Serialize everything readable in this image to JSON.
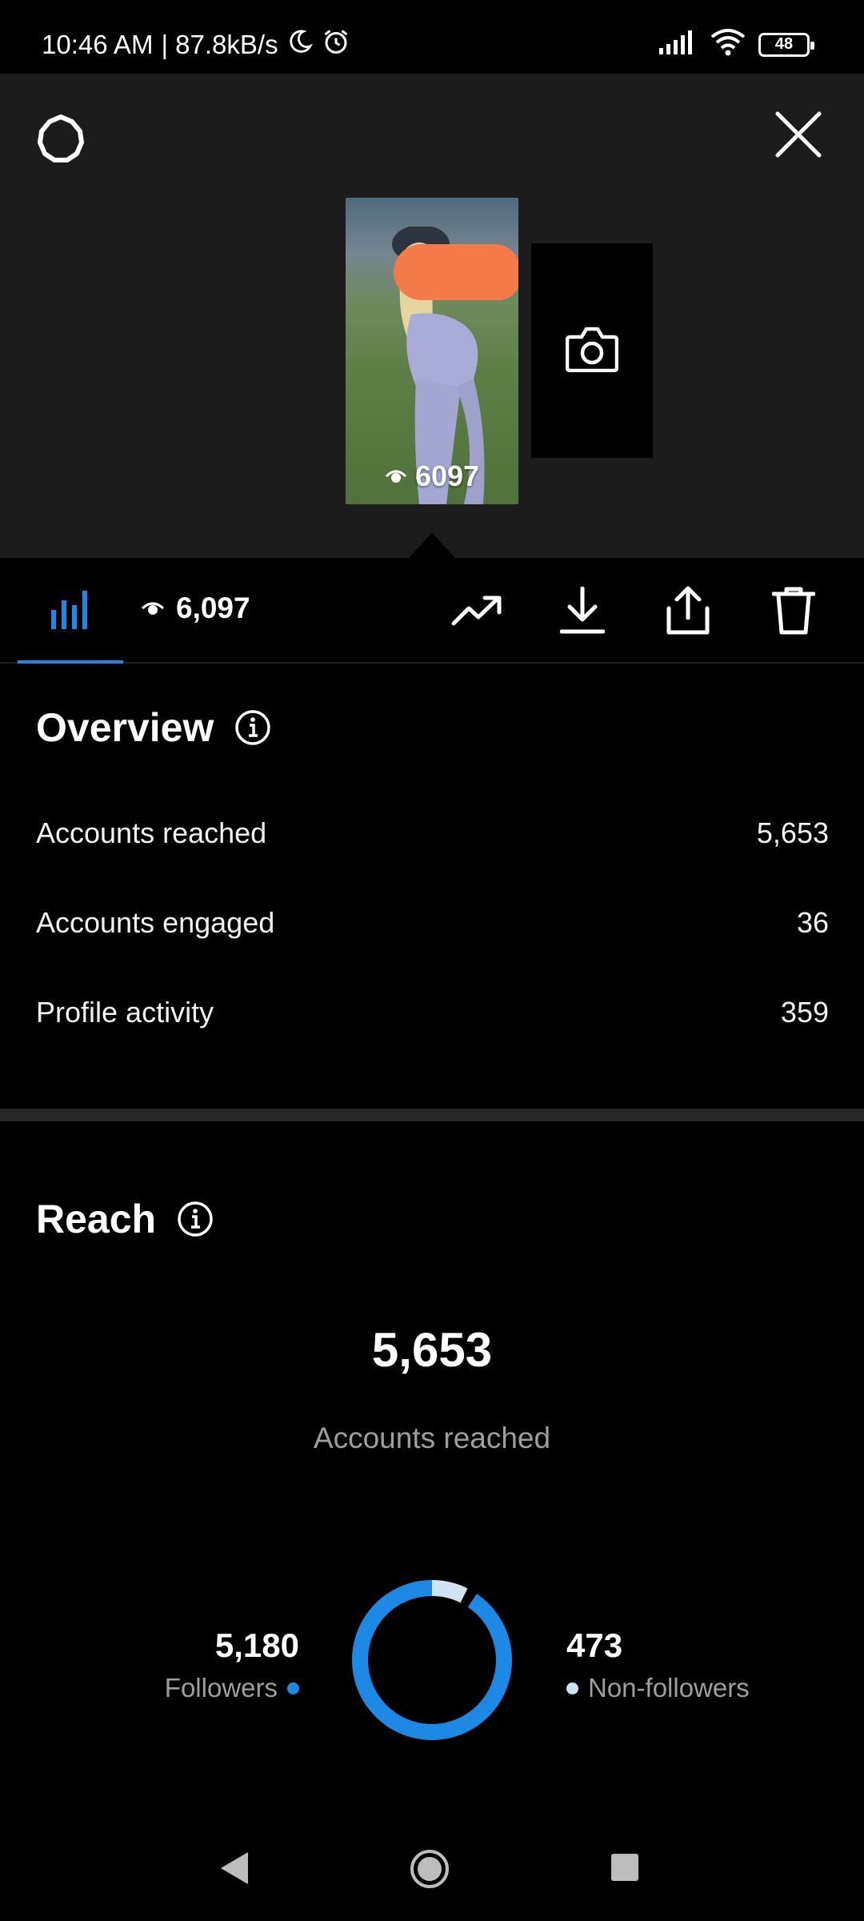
{
  "status_bar": {
    "time": "10:46 AM",
    "network_speed": "| 87.8kB/s",
    "battery": "48",
    "icons": [
      "moon-icon",
      "alarm-icon",
      "signal-icon",
      "wifi-icon",
      "battery-icon"
    ]
  },
  "header": {
    "icons": [
      "settings-icon",
      "close-icon"
    ]
  },
  "story": {
    "thumbnail_views": "6097",
    "add_story_icon": "camera-icon"
  },
  "toolbar": {
    "views": "6,097",
    "icons": [
      "bar-chart-icon",
      "eye-icon",
      "trending-icon",
      "download-icon",
      "share-icon",
      "trash-icon"
    ]
  },
  "overview": {
    "title": "Overview",
    "rows": [
      {
        "label": "Accounts reached",
        "value": "5,653"
      },
      {
        "label": "Accounts engaged",
        "value": "36"
      },
      {
        "label": "Profile activity",
        "value": "359"
      }
    ]
  },
  "reach": {
    "title": "Reach",
    "total": "5,653",
    "total_label": "Accounts reached",
    "followers": {
      "value": "5,180",
      "label": "Followers",
      "color": "#1e88e5"
    },
    "non_followers": {
      "value": "473",
      "label": "Non-followers",
      "color": "#cfe3f5"
    },
    "followers_fraction": 0.916
  },
  "colors": {
    "accent": "#1e88e5",
    "background": "#000000",
    "panel": "#1c1c1c"
  }
}
